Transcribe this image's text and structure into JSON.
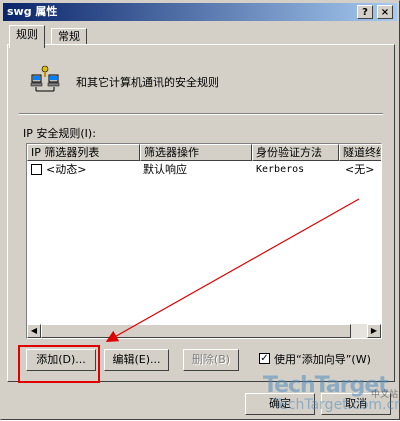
{
  "window": {
    "title": "swg 属性",
    "help_button": "?",
    "close_button": "×"
  },
  "tabs": [
    {
      "label": "规则",
      "active": true
    },
    {
      "label": "常规",
      "active": false
    }
  ],
  "header": {
    "description": "和其它计算机通讯的安全规则"
  },
  "rules_list": {
    "label": "IP 安全规则(I):",
    "columns": [
      "IP 筛选器列表",
      "筛选器操作",
      "身份验证方法",
      "隧道终结"
    ],
    "rows": [
      {
        "checked": false,
        "filter_list": "<动态>",
        "filter_action": "默认响应",
        "auth_method": "Kerberos",
        "tunnel": "<无>"
      }
    ]
  },
  "buttons": {
    "add": "添加(D)...",
    "edit": "编辑(E)...",
    "delete": "删除(B)",
    "wizard_label": "使用“添加向导”(W)",
    "wizard_checked": true,
    "ok": "确定",
    "cancel": "取消"
  },
  "watermark": {
    "brand": "TechTarget",
    "url": "TechTarget.com.cn",
    "lang": "中文站"
  },
  "colors": {
    "dialog_bg": "#d4d0c8",
    "title_bar": "#0a246a",
    "highlight_box": "#e00000",
    "arrow": "#e00000"
  }
}
